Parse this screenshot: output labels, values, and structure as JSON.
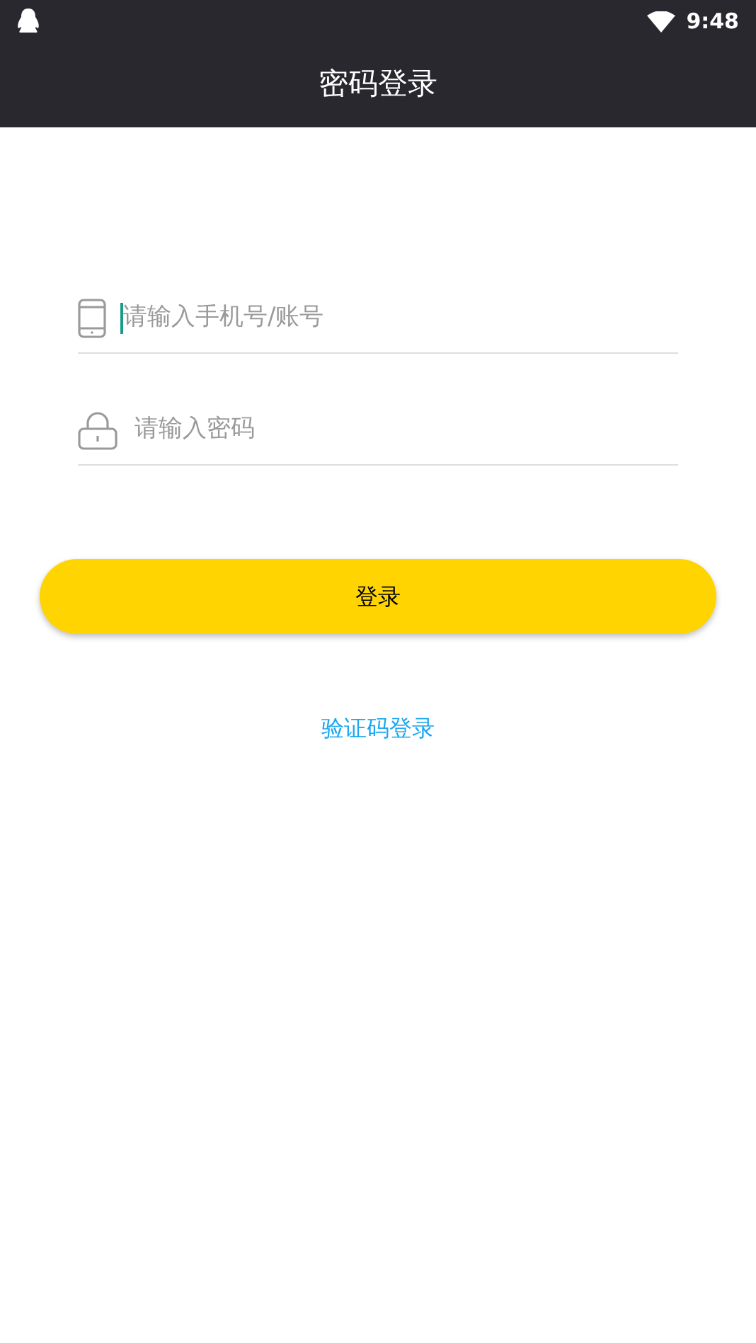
{
  "status_bar": {
    "time": "9:48"
  },
  "header": {
    "title": "密码登录"
  },
  "fields": [
    {
      "kind": "phone",
      "placeholder": "请输入手机号/账号",
      "focused": true
    },
    {
      "kind": "password",
      "placeholder": "请输入密码",
      "focused": false
    }
  ],
  "login_button": {
    "label": "登录"
  },
  "alt_login_link": {
    "label": "验证码登录"
  }
}
